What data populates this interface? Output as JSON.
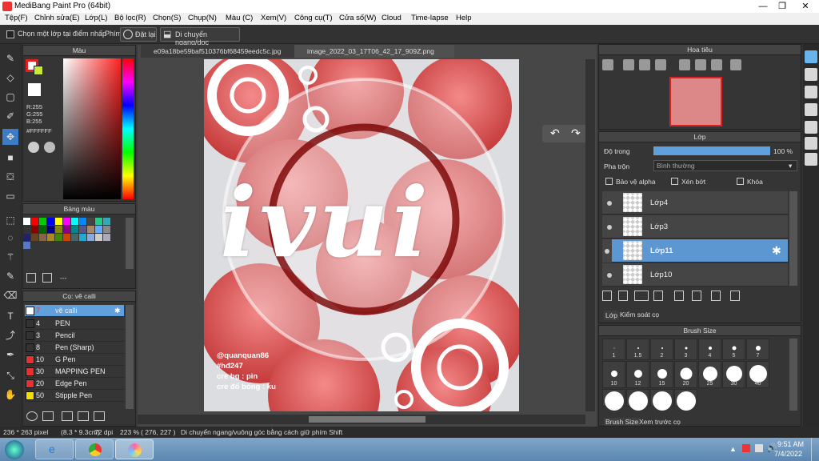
{
  "window": {
    "title": "MediBang Paint Pro (64bit)"
  },
  "menu": [
    "Tệp(F)",
    "Chỉnh sửa(E)",
    "Lớp(L)",
    "Bộ lọc(R)",
    "Chọn(S)",
    "Chụp(N)",
    "Màu (C)",
    "Xem(V)",
    "Công cụ(T)",
    "Cửa số(W)",
    "Cloud",
    "Time-lapse",
    "Help"
  ],
  "toolbar": {
    "select_layer": "Chọn một lớp tại điểm nhấp",
    "hotkey": "Phím",
    "reset": "Đặt lại",
    "move_mode": "Di chuyển ngang/dọc"
  },
  "color_panel": {
    "title": "Màu",
    "r": "R:255",
    "g": "G:255",
    "b": "B:255",
    "hex": "#FFFFFF"
  },
  "palette": {
    "title": "Bảng màu",
    "dash": "---"
  },
  "brushes": {
    "title": "Cọ: vẽ calli",
    "items": [
      {
        "num": "7",
        "name": "vẽ calli",
        "color": "#ffffff"
      },
      {
        "num": "4",
        "name": "PEN",
        "color": "#333333"
      },
      {
        "num": "3",
        "name": "Pencil",
        "color": "#333333"
      },
      {
        "num": "8",
        "name": "Pen (Sharp)",
        "color": "#333333"
      },
      {
        "num": "10",
        "name": "G Pen",
        "color": "#e83030"
      },
      {
        "num": "30",
        "name": "MAPPING PEN",
        "color": "#e83030"
      },
      {
        "num": "20",
        "name": "Edge Pen",
        "color": "#e83030"
      },
      {
        "num": "50",
        "name": "Stipple Pen",
        "color": "#f0e000"
      }
    ]
  },
  "tabs": {
    "tab1": "e09a18be59baf510376bf68459eedc5c.jpg",
    "tab2": "image_2022_03_17T06_42_17_909Z.png"
  },
  "canvas": {
    "art_text": "ivui",
    "credits": [
      "@quanquan86",
      "#hđ247",
      "cre bg : pin",
      "cre đổ bóng : ku"
    ]
  },
  "navigator": {
    "title": "Hoa tiêu"
  },
  "layers": {
    "title": "Lớp",
    "opacity_label": "Độ trong",
    "opacity_value": "100 %",
    "opacity": 1.0,
    "blend_label": "Pha trộn",
    "blend_value": "Bình thường",
    "protect_alpha": "Bảo vệ alpha",
    "clipping": "Xén bớt",
    "lock": "Khóa",
    "items": [
      {
        "name": "Lớp4"
      },
      {
        "name": "Lớp3"
      },
      {
        "name": "Lớp11"
      },
      {
        "name": "Lớp10"
      }
    ],
    "tab_layer": "Lớp",
    "tab_control": "Kiểm soát cọ"
  },
  "brush_size": {
    "title": "Brush Size",
    "sizes": [
      "1",
      "1.5",
      "2",
      "3",
      "4",
      "5",
      "7",
      "10",
      "12",
      "15",
      "20",
      "25",
      "30",
      "40"
    ],
    "tab_size": "Brush Size",
    "tab_preview": "Xem trước cọ"
  },
  "status": {
    "dims": "236 * 263 pixel",
    "inch": "(8.3 * 9.3cm)",
    "dpi": "72 dpi",
    "zoom": "223 %",
    "coords": "( 276, 227 )",
    "hint": "Di chuyển ngang/vuông góc bằng cách giữ phím Shift"
  },
  "taskbar": {
    "time": "9:51 AM",
    "date": "7/4/2022"
  }
}
